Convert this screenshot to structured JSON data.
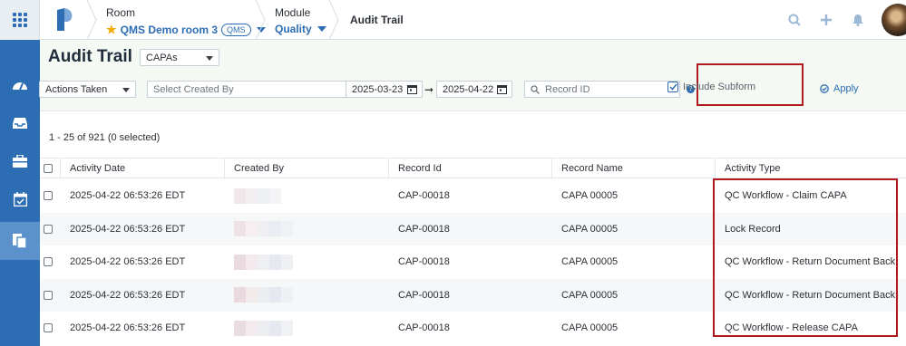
{
  "topbar": {
    "room_label": "Room",
    "room_value": "QMS Demo room 3",
    "room_badge": "QMS",
    "module_label": "Module",
    "module_value": "Quality",
    "current_page": "Audit Trail",
    "icons": [
      "search-icon",
      "plus-icon",
      "bell-icon"
    ]
  },
  "sidebar": {
    "items": [
      {
        "icon": "dashboard-icon"
      },
      {
        "icon": "inbox-icon"
      },
      {
        "icon": "briefcase-icon"
      },
      {
        "icon": "calendar-check-icon"
      },
      {
        "icon": "documents-icon",
        "active": true
      }
    ]
  },
  "header": {
    "title": "Audit Trail",
    "record_type": "CAPAs"
  },
  "filters": {
    "action": "Actions Taken",
    "created_by_placeholder": "Select Created By",
    "date_from": "2025-03-23",
    "date_to": "2025-04-22",
    "arrow": "➞",
    "record_id_placeholder": "Record ID",
    "help": "?",
    "include_subform": "Include Subform",
    "apply": "Apply"
  },
  "summary": {
    "count_text": "1 - 25 of 921 (0 selected)"
  },
  "table": {
    "columns": [
      "Activity Date",
      "Created By",
      "Record Id",
      "Record Name",
      "Activity Type"
    ],
    "rows": [
      {
        "date": "2025-04-22 06:53:26 EDT",
        "record_id": "CAP-00018",
        "record_name": "CAPA 00005",
        "activity": "QC Workflow - Claim CAPA"
      },
      {
        "date": "2025-04-22 06:53:26 EDT",
        "record_id": "CAP-00018",
        "record_name": "CAPA 00005",
        "activity": "Lock Record"
      },
      {
        "date": "2025-04-22 06:53:26 EDT",
        "record_id": "CAP-00018",
        "record_name": "CAPA 00005",
        "activity": "QC Workflow - Return Document Back"
      },
      {
        "date": "2025-04-22 06:53:26 EDT",
        "record_id": "CAP-00018",
        "record_name": "CAPA 00005",
        "activity": "QC Workflow - Return Document Back"
      },
      {
        "date": "2025-04-22 06:53:26 EDT",
        "record_id": "CAP-00018",
        "record_name": "CAPA 00005",
        "activity": "QC Workflow - Release CAPA"
      }
    ]
  },
  "colors": {
    "brand": "#2c6db3",
    "highlight_box": "#b0191e",
    "header_bg": "#f4f9f3"
  }
}
